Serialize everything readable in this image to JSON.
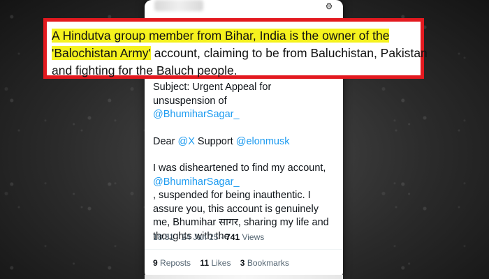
{
  "callout": {
    "hl1": "A Hindutva group member from Bihar, India is the owner of the",
    "hl2": "'Balochistan Army'",
    "line2_rest": " account, claiming to be from Baluchistan, Pakistan",
    "line3": "and fighting for the Baluch people."
  },
  "tweet": {
    "subject_line": "Subject: Urgent Appeal for unsuspension of",
    "subject_mention": "@BhumiharSagar_",
    "dear": "Dear ",
    "mention_x": "@X",
    "support": " Support ",
    "mention_elon": "@elonmusk",
    "p3_start": "I was disheartened to find my  account,",
    "p3_mention": "@BhumiharSagar_",
    "p3_end": ", suspended for being inauthentic. I assure you, this account is genuinely me, Bhumihar सागर, sharing my life and thoughts with the",
    "time": "18:31",
    "date": "24 Jan 25",
    "views_count": "741",
    "views_label": "Views",
    "reposts_count": "9",
    "reposts_label": "Reposts",
    "likes_count": "11",
    "likes_label": "Likes",
    "bookmarks_count": "3",
    "bookmarks_label": "Bookmarks"
  },
  "colors": {
    "highlight": "#f5f21e",
    "callout_border": "#e3191f",
    "mention": "#1d9bf0"
  },
  "icons": {
    "more": "more-options-icon"
  }
}
